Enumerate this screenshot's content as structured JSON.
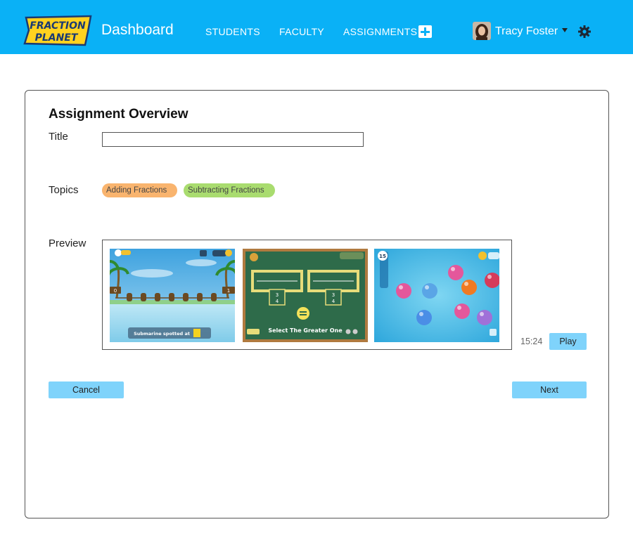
{
  "header": {
    "logo_line1": "FRACTION",
    "logo_line2": "PLANET",
    "title": "Dashboard",
    "nav": [
      "STUDENTS",
      "FACULTY",
      "ASSIGNMENTS"
    ],
    "user_name": "Tracy Foster",
    "accent": "#0ab1f6"
  },
  "overview": {
    "heading": "Assignment Overview",
    "title_label": "Title",
    "title_value": "",
    "topics_label": "Topics",
    "topics": [
      {
        "label": "Adding Fractions",
        "color": "#f9b46e"
      },
      {
        "label": "Subtracting Fractions",
        "color": "#a9dc6f"
      }
    ],
    "preview_label": "Preview",
    "games": [
      {
        "caption": "Submarine spotted at",
        "score_left": "0",
        "score_right": "1"
      },
      {
        "caption": "Select The Greater One",
        "num_top": "3",
        "num_bottom": "4"
      },
      {
        "counter": "15"
      }
    ],
    "duration": "15:24",
    "play_label": "Play",
    "cancel_label": "Cancel",
    "next_label": "Next"
  }
}
